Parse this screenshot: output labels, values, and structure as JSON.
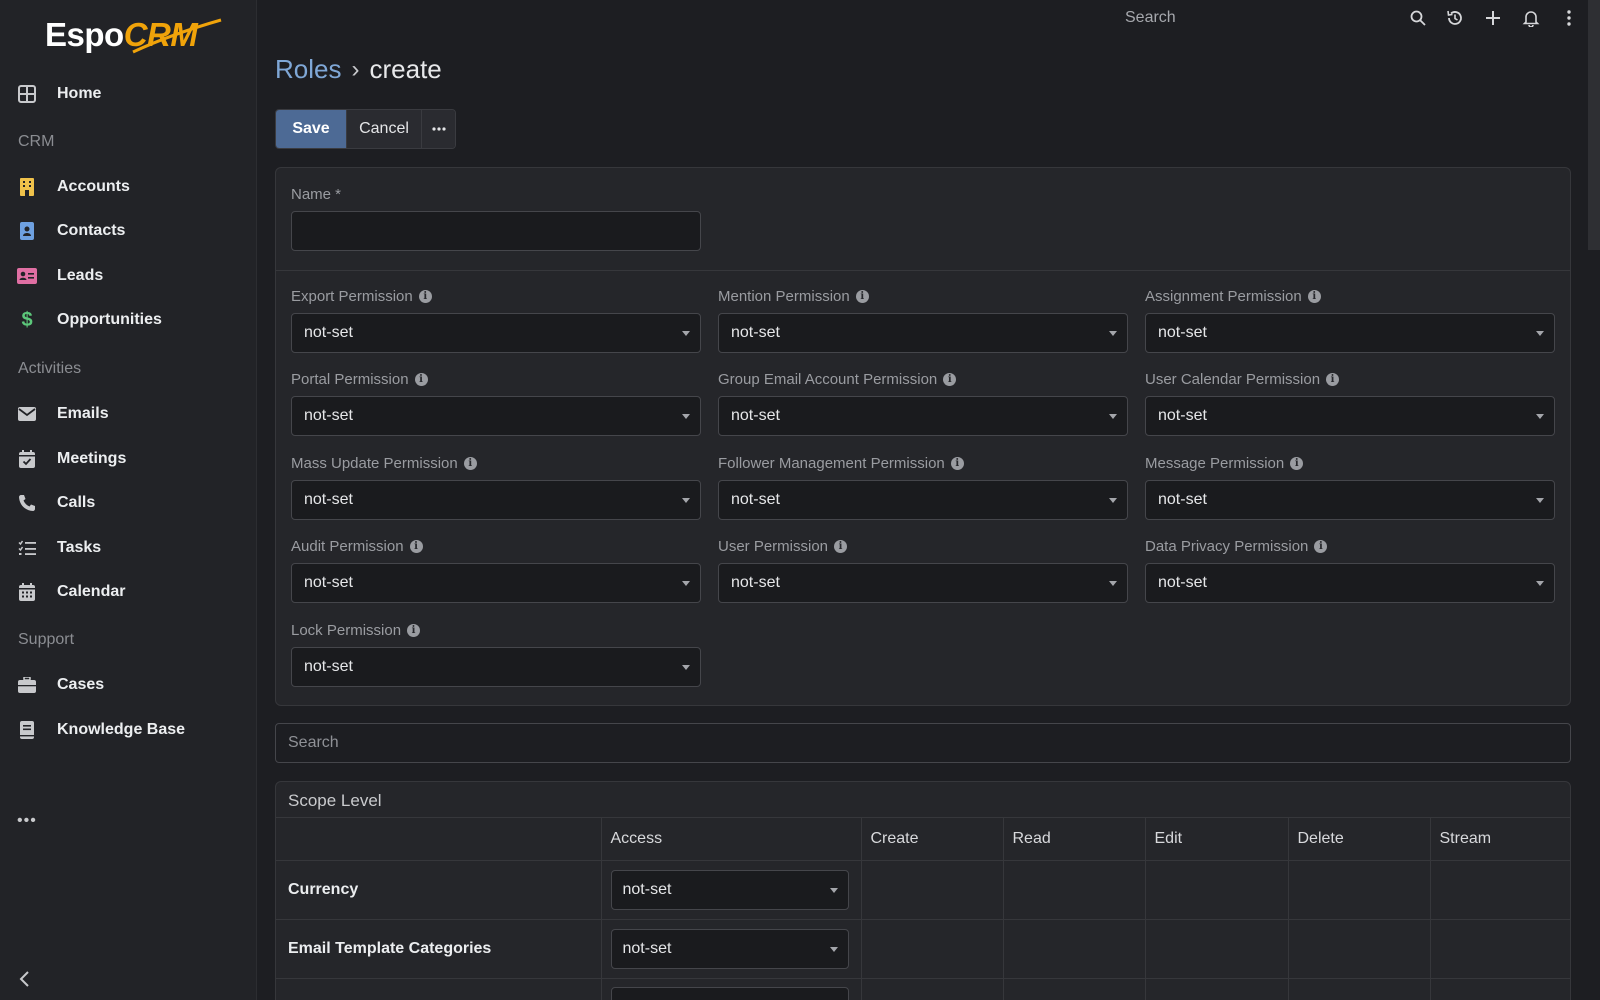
{
  "app": {
    "logo_main": "Espo",
    "logo_accent": "CRM"
  },
  "sidebar": {
    "items": [
      {
        "label": "Home",
        "icon": "grid-icon"
      },
      {
        "label": "Accounts",
        "icon": "building-icon",
        "color": "#f0c24b"
      },
      {
        "label": "Contacts",
        "icon": "contact-card-icon",
        "color": "#6ea0e0"
      },
      {
        "label": "Leads",
        "icon": "id-card-icon",
        "color": "#e06fa3"
      },
      {
        "label": "Opportunities",
        "icon": "dollar-icon",
        "color": "#5cc77a"
      },
      {
        "label": "Emails",
        "icon": "envelope-icon"
      },
      {
        "label": "Meetings",
        "icon": "calendar-check-icon"
      },
      {
        "label": "Calls",
        "icon": "phone-icon"
      },
      {
        "label": "Tasks",
        "icon": "checklist-icon"
      },
      {
        "label": "Calendar",
        "icon": "calendar-icon"
      },
      {
        "label": "Cases",
        "icon": "briefcase-icon"
      },
      {
        "label": "Knowledge Base",
        "icon": "book-icon"
      }
    ],
    "sections": {
      "crm": "CRM",
      "activities": "Activities",
      "support": "Support"
    },
    "more": "•••"
  },
  "topbar": {
    "search_placeholder": "Search"
  },
  "breadcrumb": {
    "parent": "Roles",
    "separator": "›",
    "current": "create"
  },
  "buttons": {
    "save": "Save",
    "cancel": "Cancel",
    "more": "•••"
  },
  "form": {
    "name_label": "Name *",
    "name_value": "",
    "permissions": [
      {
        "label": "Export Permission",
        "value": "not-set"
      },
      {
        "label": "Mention Permission",
        "value": "not-set"
      },
      {
        "label": "Assignment Permission",
        "value": "not-set"
      },
      {
        "label": "Portal Permission",
        "value": "not-set"
      },
      {
        "label": "Group Email Account Permission",
        "value": "not-set"
      },
      {
        "label": "User Calendar Permission",
        "value": "not-set"
      },
      {
        "label": "Mass Update Permission",
        "value": "not-set"
      },
      {
        "label": "Follower Management Permission",
        "value": "not-set"
      },
      {
        "label": "Message Permission",
        "value": "not-set"
      },
      {
        "label": "Audit Permission",
        "value": "not-set"
      },
      {
        "label": "User Permission",
        "value": "not-set"
      },
      {
        "label": "Data Privacy Permission",
        "value": "not-set"
      },
      {
        "label": "Lock Permission",
        "value": "not-set"
      }
    ]
  },
  "scope_search": {
    "placeholder": "Search"
  },
  "scope": {
    "title": "Scope Level",
    "columns": [
      "",
      "Access",
      "Create",
      "Read",
      "Edit",
      "Delete",
      "Stream"
    ],
    "rows": [
      {
        "name": "Currency",
        "access": "not-set"
      },
      {
        "name": "Email Template Categories",
        "access": "not-set"
      },
      {
        "name": "",
        "access": ""
      }
    ]
  },
  "colors": {
    "accent": "#4d6a95",
    "link": "#7fa7d6",
    "background": "#1d1e22",
    "sidebar": "#222327"
  }
}
